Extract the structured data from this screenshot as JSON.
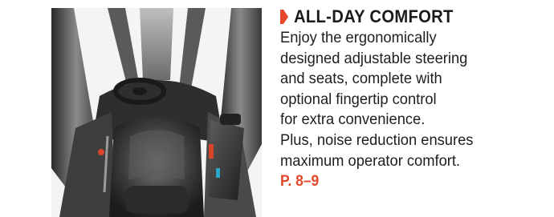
{
  "section": {
    "heading": "ALL-DAY COMFORT",
    "accent_color": "#e4472a",
    "body_lines": [
      "Enjoy the ergonomically",
      "designed adjustable steering",
      "and seats, complete with",
      "optional fingertip control",
      "for extra convenience.",
      "Plus, noise reduction ensures",
      "maximum operator comfort."
    ],
    "page_ref": "P. 8–9"
  },
  "image": {
    "subject": "forklift-operator-cab"
  }
}
